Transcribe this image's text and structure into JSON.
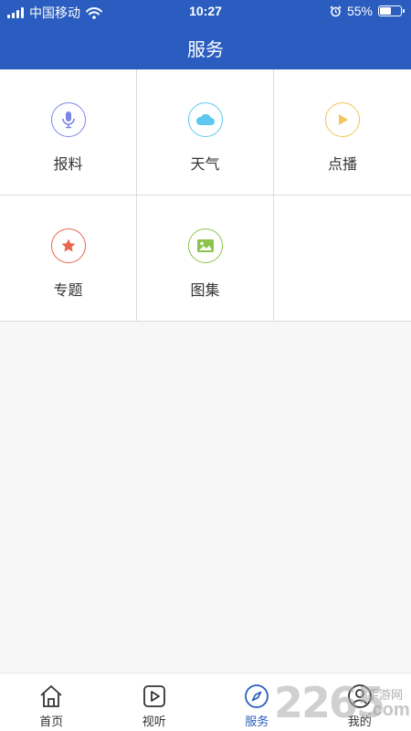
{
  "status_bar": {
    "carrier": "中国移动",
    "time": "10:27",
    "battery_percent": "55%",
    "battery_level": 0.55,
    "icons": [
      "signal-icon",
      "wifi-icon",
      "alarm-icon",
      "battery-icon"
    ]
  },
  "header": {
    "title": "服务",
    "background_color": "#2a5dbf"
  },
  "services": [
    {
      "label": "报料",
      "icon": "microphone-icon",
      "color": "#7a86e8"
    },
    {
      "label": "天气",
      "icon": "cloud-icon",
      "color": "#5cc8ef"
    },
    {
      "label": "点播",
      "icon": "play-icon",
      "color": "#f3c55c"
    },
    {
      "label": "专题",
      "icon": "star-icon",
      "color": "#e8644a"
    },
    {
      "label": "图集",
      "icon": "image-icon",
      "color": "#8cc34b"
    }
  ],
  "tabbar": {
    "active_color": "#2a5dbf",
    "items": [
      {
        "label": "首页",
        "icon": "home-icon",
        "active": false
      },
      {
        "label": "视听",
        "icon": "video-play-icon",
        "active": false
      },
      {
        "label": "服务",
        "icon": "compass-icon",
        "active": true
      },
      {
        "label": "我的",
        "icon": "user-icon",
        "active": false
      }
    ]
  },
  "watermark": {
    "brand": "2265",
    "site_name": "手游网",
    "domain": ".com"
  }
}
